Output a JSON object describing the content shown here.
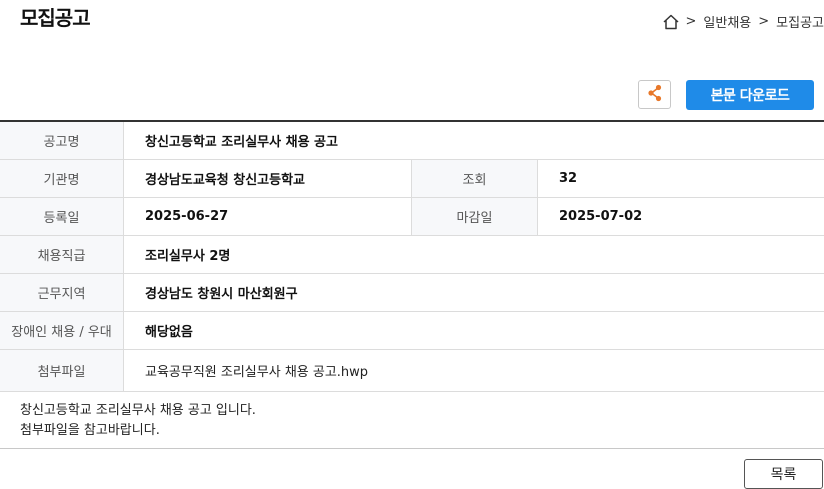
{
  "page": {
    "title": "모집공고"
  },
  "breadcrumb": {
    "sep1": ">",
    "item1": "일반채용",
    "sep2": ">",
    "item2": "모집공고"
  },
  "toolbar": {
    "download_label": "본문 다운로드"
  },
  "info": {
    "title_label": "공고명",
    "title_value": "창신고등학교 조리실무사 채용 공고",
    "org_label": "기관명",
    "org_value": "경상남도교육청 창신고등학교",
    "views_label": "조회",
    "views_value": "32",
    "reg_label": "등록일",
    "reg_value": "2025-06-27",
    "deadline_label": "마감일",
    "deadline_value": "2025-07-02",
    "job_label": "채용직급",
    "job_value": "조리실무사 2명",
    "location_label": "근무지역",
    "location_value": "경상남도 창원시 마산회원구",
    "disabled_label": "장애인 채용 / 우대",
    "disabled_value": "해당없음",
    "attach_label": "첨부파일",
    "attach_value": "교육공무직원 조리실무사 채용 공고.hwp"
  },
  "body": {
    "line1": "창신고등학교 조리실무사 채용 공고 입니다.",
    "line2": "첨부파일을 참고바랍니다."
  },
  "footer": {
    "list_label": "목록"
  },
  "colors": {
    "accent": "#1f8be8",
    "share_icon": "#e8782a"
  }
}
